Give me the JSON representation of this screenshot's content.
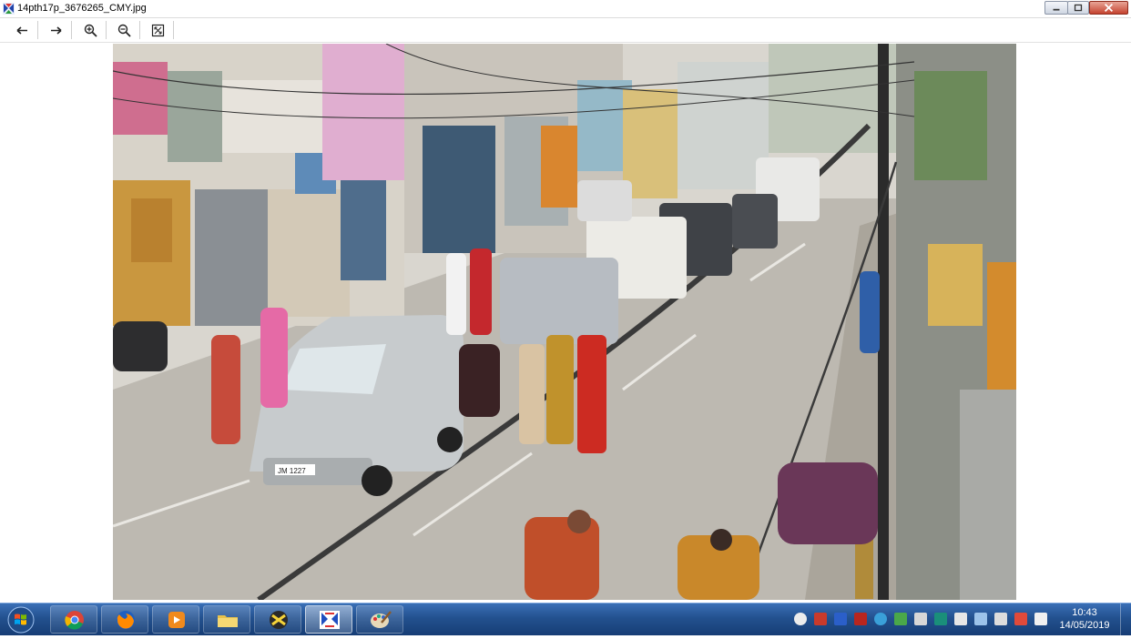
{
  "window": {
    "title": "14pth17p_3676265_CMY.jpg",
    "icon": "photo-viewer-icon",
    "controls": [
      "minimize-icon",
      "maximize-icon",
      "close-icon"
    ]
  },
  "toolbar": {
    "buttons": [
      {
        "name": "previous-image-button",
        "icon": "arrow-left-icon"
      },
      {
        "name": "next-image-button",
        "icon": "arrow-right-icon"
      },
      {
        "name": "zoom-in-button",
        "icon": "zoom-in-icon"
      },
      {
        "name": "zoom-out-button",
        "icon": "zoom-out-icon"
      },
      {
        "name": "fit-to-window-button",
        "icon": "fit-window-icon"
      }
    ]
  },
  "photo": {
    "car_plate": "JM 1227"
  },
  "taskbar": {
    "apps": [
      "chrome-icon",
      "firefox-icon",
      "media-player-icon",
      "file-explorer-icon",
      "xnview-icon",
      "viewer-icon",
      "paint-icon"
    ],
    "active_app": "viewer-icon",
    "clock": {
      "time": "10:43",
      "date": "14/05/2019"
    }
  },
  "colors": {
    "taskbar": "#23518f",
    "close_button": "#c5432f",
    "road": "#bdb9b1"
  }
}
